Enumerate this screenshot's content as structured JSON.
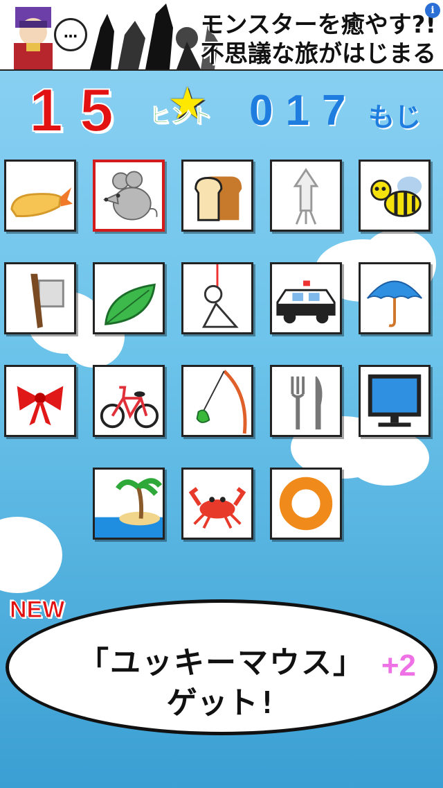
{
  "ad": {
    "bubble": "…",
    "line1": "モンスターを癒やす?!",
    "line2": "不思議な旅がはじまる",
    "info": "i"
  },
  "header": {
    "count": "15",
    "hint_label": "ヒント",
    "chars": "017",
    "chars_unit": "もじ"
  },
  "tiles": [
    {
      "icon": "fried-shrimp-icon"
    },
    {
      "icon": "mouse-icon",
      "selected": true
    },
    {
      "icon": "bread-icon"
    },
    {
      "icon": "squid-icon"
    },
    {
      "icon": "bee-icon"
    },
    {
      "icon": "axe-icon"
    },
    {
      "icon": "leaf-icon"
    },
    {
      "icon": "hanging-doll-icon"
    },
    {
      "icon": "police-car-icon"
    },
    {
      "icon": "umbrella-icon"
    },
    {
      "icon": "ribbon-icon"
    },
    {
      "icon": "bicycle-icon"
    },
    {
      "icon": "fishing-rod-icon"
    },
    {
      "icon": "fork-knife-icon"
    },
    {
      "icon": "monitor-icon"
    },
    {
      "icon": "island-icon"
    },
    {
      "icon": "crab-icon"
    },
    {
      "icon": "donut-icon"
    }
  ],
  "message": {
    "badge": "NEW",
    "line1": "「ユッキーマウス」",
    "line2": "ゲット!",
    "bonus": "+2"
  },
  "colors": {
    "count": "#e31212",
    "chars": "#1f7de0",
    "hint": "#25a52a",
    "bonus": "#ee72e6",
    "selected_border": "#d41b1b"
  }
}
